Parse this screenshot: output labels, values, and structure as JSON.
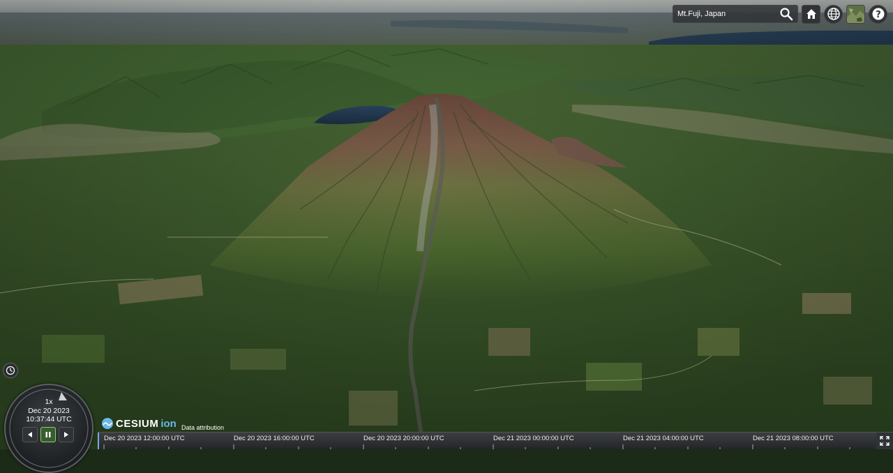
{
  "search": {
    "value": "Mt.Fuji, Japan",
    "placeholder": ""
  },
  "toolbar": {
    "search_icon": "search-icon",
    "home_icon": "home-icon",
    "scene_mode_icon": "globe-icon",
    "base_layer_icon": "imagery-layer-thumbnail",
    "help_icon": "help-icon"
  },
  "animation": {
    "speed": "1x",
    "date": "Dec 20 2023",
    "time": "10:37:44 UTC",
    "clock_icon": "clock-icon",
    "reverse_icon": "play-reverse-icon",
    "pause_icon": "pause-icon",
    "play_icon": "play-icon"
  },
  "credits": {
    "logo_word": "CESIUM",
    "logo_suffix": "ion",
    "attribution": "Data attribution"
  },
  "timeline": {
    "labels": [
      "Dec 20 2023 12:00:00 UTC",
      "Dec 20 2023 16:00:00 UTC",
      "Dec 20 2023 20:00:00 UTC",
      "Dec 21 2023 00:00:00 UTC",
      "Dec 21 2023 04:00:00 UTC",
      "Dec 21 2023 08:00:00 UTC"
    ]
  },
  "fullscreen_icon": "fullscreen-icon",
  "colors": {
    "accent": "#8bd46a",
    "toolbar_bg": "#303336",
    "lake": "#1f3346",
    "forest": "#3b5a2b",
    "summit": "#7a5a4a"
  }
}
